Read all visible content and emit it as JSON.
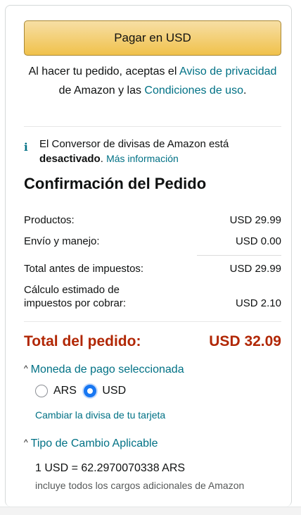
{
  "pay_button": {
    "label": "Pagar en USD"
  },
  "legal": {
    "prefix": "Al hacer tu pedido, aceptas el ",
    "privacy_link": "Aviso de privacidad",
    "middle": " de Amazon y las ",
    "conditions_link": "Condiciones de uso",
    "suffix": "."
  },
  "currency_converter": {
    "icon": "info-icon",
    "text_prefix": "El Conversor de divisas de Amazon está ",
    "status": "desactivado",
    "text_suffix": ". ",
    "more_link": "Más información"
  },
  "order": {
    "title": "Confirmación del Pedido",
    "lines": [
      {
        "label": "Productos:",
        "value": "USD 29.99"
      },
      {
        "label": "Envío y manejo:",
        "value": "USD 0.00"
      },
      {
        "label": "Total antes de impuestos:",
        "value": "USD 29.99"
      },
      {
        "label": "Cálculo estimado de impuestos por cobrar:",
        "value": "USD 2.10"
      }
    ],
    "total_label": "Total del pedido:",
    "total_value": "USD 32.09"
  },
  "payment_currency": {
    "toggle_label": "Moneda de pago seleccionada",
    "options": [
      {
        "label": "ARS",
        "selected": false
      },
      {
        "label": "USD",
        "selected": true
      }
    ],
    "change_link": "Cambiar la divisa de tu tarjeta"
  },
  "exchange_rate": {
    "toggle_label": "Tipo de Cambio Aplicable",
    "rate": "1 USD = 62.2970070338 ARS",
    "note": "incluye todos los cargos adicionales de Amazon"
  },
  "colors": {
    "link": "#007185",
    "total": "#b12704",
    "button": "#f0c14b",
    "radio_selected": "#1877f2"
  }
}
